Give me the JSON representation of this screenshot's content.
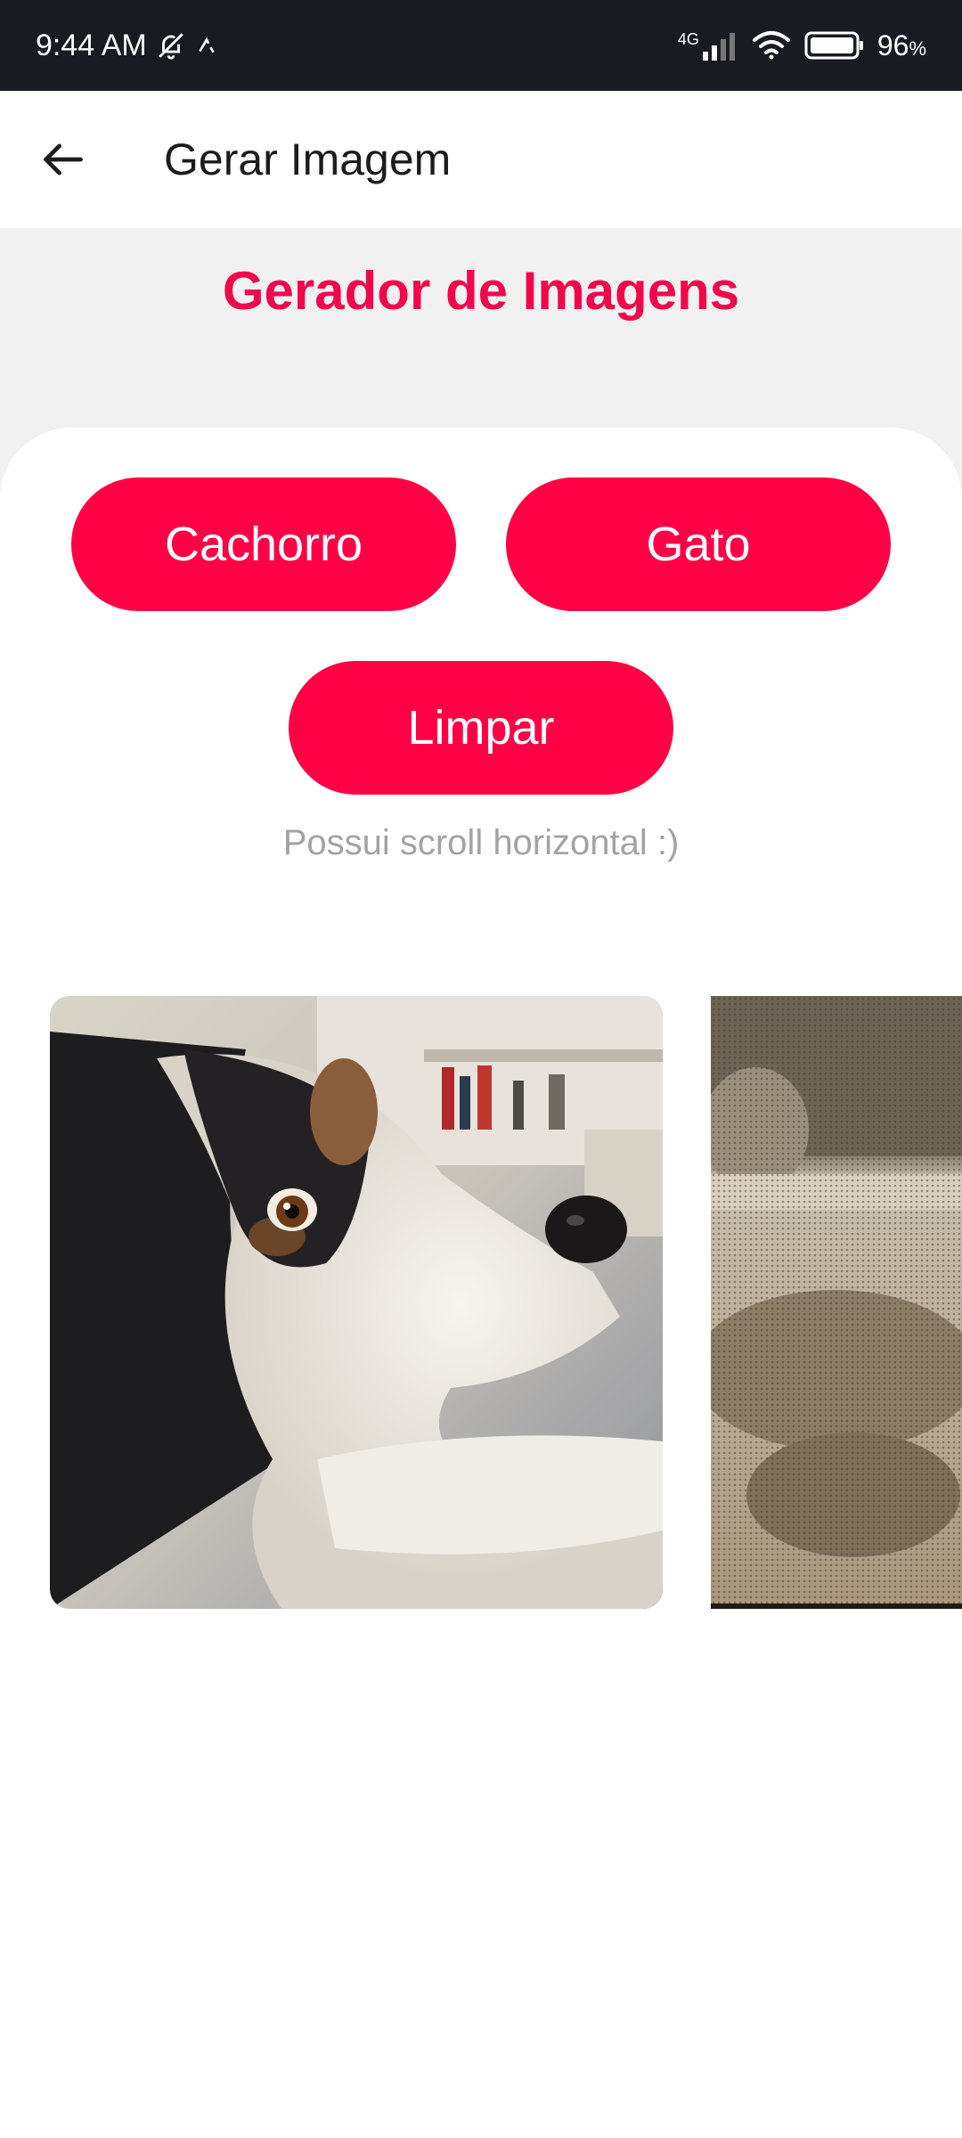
{
  "status_bar": {
    "time": "9:44 AM",
    "network": "4G",
    "battery": "96",
    "battery_unit": "%"
  },
  "app_bar": {
    "title": "Gerar Imagem"
  },
  "main": {
    "heading": "Gerador de Imagens",
    "buttons": {
      "dog": "Cachorro",
      "cat": "Gato",
      "clear": "Limpar"
    },
    "hint": "Possui scroll horizontal :)"
  },
  "gallery": {
    "images": [
      {
        "subject": "dog-photo"
      },
      {
        "subject": "cat-photo"
      }
    ]
  },
  "colors": {
    "accent": "#ff0045",
    "heading": "#f2064a",
    "status_bar_bg": "#181b22",
    "top_area_bg": "#f1f1f2",
    "hint_text": "#a3a3a3"
  }
}
